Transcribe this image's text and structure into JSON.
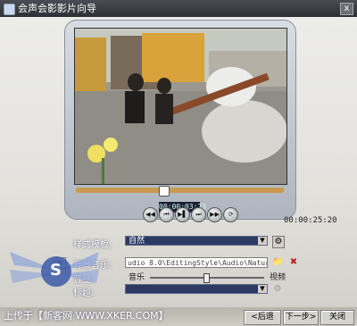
{
  "window": {
    "title": "会声会影影片向导",
    "close_label": "x"
  },
  "player": {
    "timecode": "00:00:03:23",
    "duration": "00:00:25:20",
    "controls": [
      "◀◀",
      "⏮",
      "▶▌",
      "⏭",
      "▶▶",
      "⟳"
    ]
  },
  "form": {
    "template_label": "样式模板:",
    "template_value": "自然",
    "background_music_label": "背景音乐:",
    "music_path": "udio 8.0\\EditingStyle\\Audio\\Natural.mpa",
    "volume_label": "音量:",
    "volume_left": "音乐",
    "volume_right": "视频",
    "title_label": "标题:",
    "title_value": ""
  },
  "footer": {
    "prev_button": "<后退",
    "next_button": "下一步>",
    "close_button": "关闭"
  },
  "watermark": {
    "strip_text": "上传于【新客网 WWW.XKER.COM】",
    "logo_text": "S"
  }
}
